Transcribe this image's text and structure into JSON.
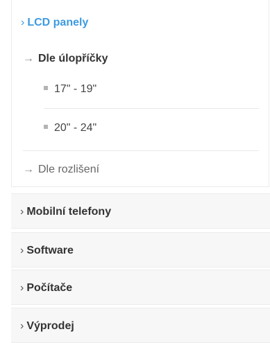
{
  "category_menu": {
    "active_category": {
      "chevron": "›",
      "label": "LCD panely",
      "subcategories": [
        {
          "arrow": "→",
          "label": "Dle úlopříčky",
          "items": [
            {
              "label": "17\" - 19\""
            },
            {
              "label": "20\" - 24\""
            }
          ]
        },
        {
          "arrow": "→",
          "label": "Dle rozlišení"
        }
      ]
    },
    "categories": [
      {
        "chevron": "›",
        "label": "Mobilní telefony"
      },
      {
        "chevron": "›",
        "label": "Software"
      },
      {
        "chevron": "›",
        "label": "Počítače"
      },
      {
        "chevron": "›",
        "label": "Výprodej"
      }
    ],
    "colors": {
      "active_link": "#3e9ae0",
      "category_bg": "#f7f7f7",
      "border": "#ececec",
      "text_dark": "#333333",
      "text_muted": "#666666"
    }
  }
}
